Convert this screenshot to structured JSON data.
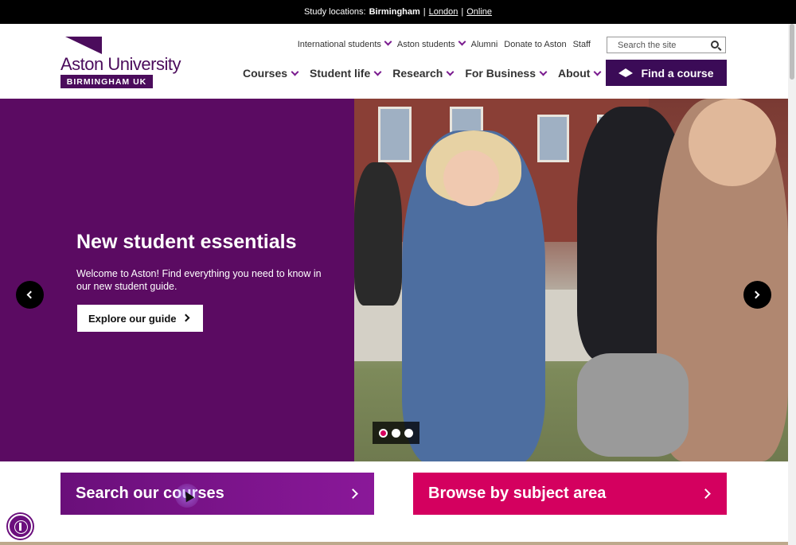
{
  "topbar": {
    "prefix": "Study locations:",
    "current": "Birmingham",
    "sep": "|",
    "link1": "London",
    "link2": "Online"
  },
  "logo": {
    "name": "Aston University",
    "sub": "BIRMINGHAM UK"
  },
  "utility_nav": [
    "International students",
    "Aston students",
    "Alumni",
    "Donate to Aston",
    "Staff"
  ],
  "search": {
    "placeholder": "Search the site"
  },
  "main_nav": [
    "Courses",
    "Student life",
    "Research",
    "For Business",
    "About"
  ],
  "find_course": "Find a course",
  "hero": {
    "title": "New student essentials",
    "text": "Welcome to Aston! Find everything you need to know in our new student guide.",
    "button": "Explore our guide"
  },
  "cta": {
    "search": "Search our courses",
    "browse": "Browse by subject area"
  },
  "colors": {
    "brand_purple": "#4b0c5c",
    "hero_purple": "#5b0b62",
    "cta_pink": "#d4005f"
  }
}
